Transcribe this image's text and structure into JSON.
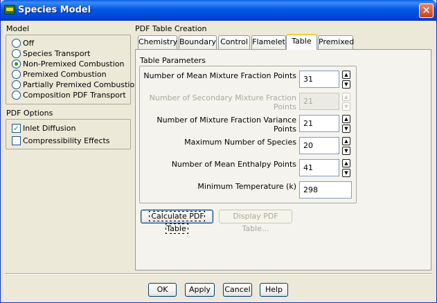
{
  "window": {
    "title": "Species Model",
    "close_glyph": "✕",
    "icon": "fluent-app-icon"
  },
  "model": {
    "label": "Model",
    "options": [
      {
        "label": "Off",
        "selected": false
      },
      {
        "label": "Species Transport",
        "selected": false
      },
      {
        "label": "Non-Premixed Combustion",
        "selected": true
      },
      {
        "label": "Premixed Combustion",
        "selected": false
      },
      {
        "label": "Partially Premixed Combustion",
        "selected": false
      },
      {
        "label": "Composition PDF Transport",
        "selected": false
      }
    ]
  },
  "pdf_options": {
    "label": "PDF Options",
    "options": [
      {
        "label": "Inlet Diffusion",
        "checked": true
      },
      {
        "label": "Compressibility Effects",
        "checked": false
      }
    ]
  },
  "pdf_table_creation": {
    "label": "PDF Table Creation",
    "tabs": [
      "Chemistry",
      "Boundary",
      "Control",
      "Flamelet",
      "Table",
      "Premixed"
    ],
    "active_tab": "Table",
    "table_parameters": {
      "label": "Table Parameters",
      "rows": [
        {
          "label": "Number of Mean Mixture Fraction Points",
          "value": "31"
        },
        {
          "label": "Number of Secondary Mixture Fraction Points",
          "value": "21"
        },
        {
          "label": "Number of Mixture Fraction Variance Points",
          "value": "21"
        },
        {
          "label": "Maximum Number of Species",
          "value": "20"
        },
        {
          "label": "Number of Mean Enthalpy Points",
          "value": "41"
        },
        {
          "label": "Minimum Temperature (k)",
          "value": "298"
        }
      ]
    },
    "calculate_button": "Calculate PDF Table",
    "display_button": "Display PDF Table..."
  },
  "footer": {
    "ok": "OK",
    "apply": "Apply",
    "cancel": "Cancel",
    "help": "Help"
  },
  "spin_glyphs": {
    "up": "▲",
    "down": "▼"
  },
  "check_glyph": "✓",
  "colors": {
    "title_bar": "#0058e6",
    "active_tab_highlight": "#ffc83c",
    "dialog_bg": "#ece9d8"
  }
}
